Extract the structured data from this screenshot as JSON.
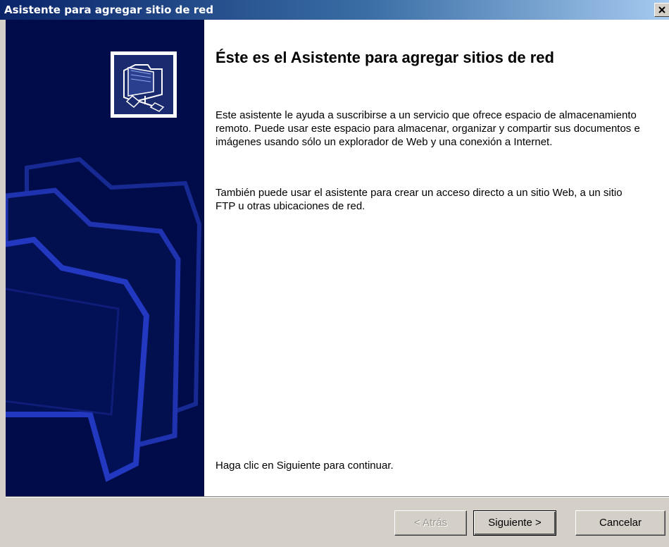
{
  "window": {
    "title": "Asistente para agregar sitio de red",
    "close_glyph": "✕"
  },
  "icons": {
    "header_icon": "network-folder-icon",
    "side_art": "folders-decorative-art"
  },
  "main": {
    "heading": "Éste es el Asistente para agregar sitios de red",
    "paragraph1": "Este asistente le ayuda a suscribirse a un servicio que ofrece espacio de almacenamiento remoto. Puede usar este espacio para almacenar, organizar y compartir sus documentos e imágenes usando sólo un explorador de Web y una conexión a Internet.",
    "paragraph2": "También puede usar el asistente para crear un acceso directo a un sitio Web, a un sitio FTP u otras ubicaciones de red.",
    "footer": "Haga clic en Siguiente para continuar."
  },
  "buttons": {
    "back": "< Atrás",
    "next": "Siguiente >",
    "cancel": "Cancelar"
  },
  "colors": {
    "titlebar_start": "#0a246a",
    "side_panel": "#000c4a",
    "face": "#d4d0c8"
  }
}
